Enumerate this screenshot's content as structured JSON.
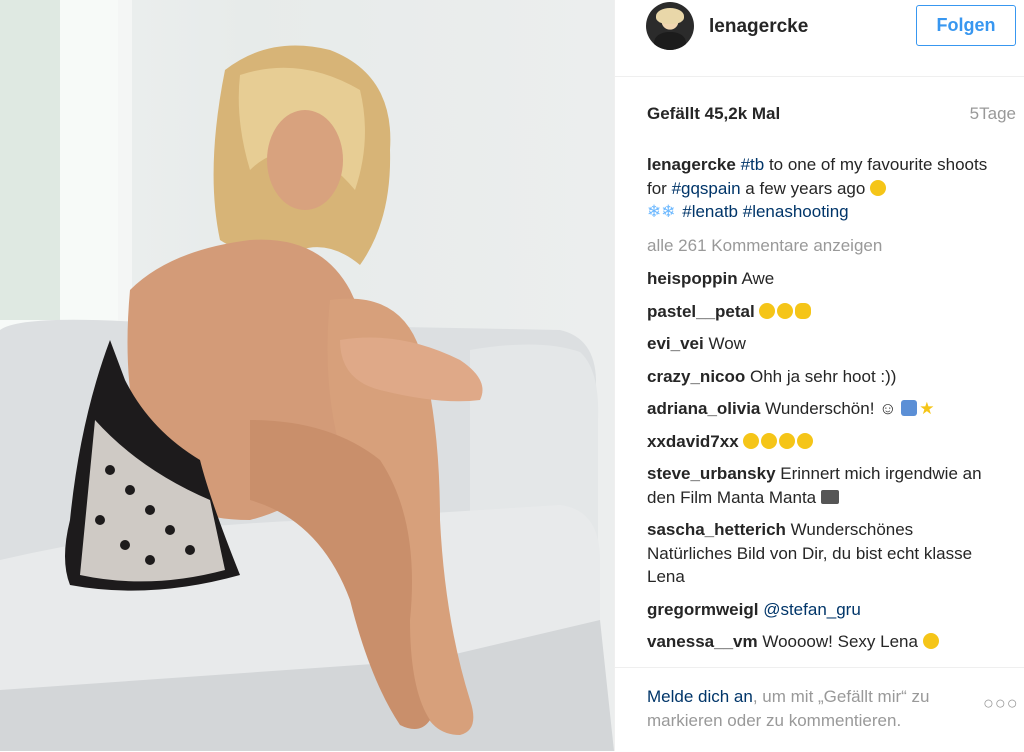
{
  "post": {
    "image_alt": "Foto"
  },
  "header": {
    "username": "lenagercke",
    "follow_label": "Folgen"
  },
  "stats": {
    "likes": "Gefällt 45,2k Mal",
    "age": "5Tage"
  },
  "caption": {
    "user": "lenagercke",
    "parts": [
      "#tb",
      " to one of my favourite shoots for ",
      "#gqspain",
      " a few years ago ",
      "#lenatb",
      "#lenashooting"
    ]
  },
  "view_all": "alle 261 Kommentare anzeigen",
  "comments": [
    {
      "user": "heispoppin",
      "text": "Awe"
    },
    {
      "user": "pastel__petal",
      "text": ""
    },
    {
      "user": "evi_vei",
      "text": "Wow"
    },
    {
      "user": "crazy_nicoo",
      "text": "Ohh ja sehr hoot :))"
    },
    {
      "user": "adriana_olivia",
      "text": "Wunderschön! ☺"
    },
    {
      "user": "xxdavid7xx",
      "text": ""
    },
    {
      "user": "steve_urbansky",
      "text": "Erinnert mich irgendwie an den Film Manta Manta"
    },
    {
      "user": "sascha_hetterich",
      "text": "Wunderschönes Natürliches Bild von Dir, du bist echt klasse Lena"
    },
    {
      "user": "gregormweigl",
      "text": "@stefan_gru"
    },
    {
      "user": "vanessa__vm",
      "text": "Woooow! Sexy Lena"
    }
  ],
  "footer": {
    "login_link": "Melde dich an",
    "login_rest": ", um mit „Gefällt mir“ zu markieren oder zu kommentieren.",
    "more_icon": "more-options-icon"
  },
  "colors": {
    "accent": "#3897f0",
    "link": "#003569",
    "muted": "#999999"
  }
}
